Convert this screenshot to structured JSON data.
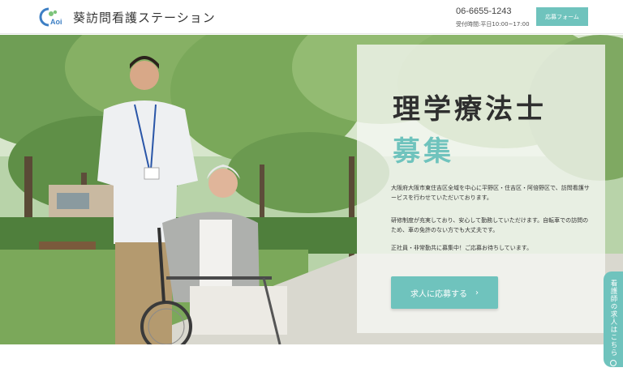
{
  "header": {
    "logo_text": "Aoi",
    "title": "葵訪問看護ステーション",
    "phone": "06-6655-1243",
    "hours": "受付時間:平日10:00~17:00",
    "apply_form_label": "応募フォーム"
  },
  "hero": {
    "headline": "理学療法士",
    "subheadline": "募集",
    "paragraphs": [
      "大阪府大阪市東住吉区全域を中心に平野区・住吉区・阿倍野区で、訪問看護サービスを行わせていただいております。",
      "研修制度が充実しており、安心して勤務していただけます。自転車での訪問のため、車の免許のない方でも大丈夫です。",
      "正社員・非常勤共に募集中！ご応募お待ちしています。"
    ],
    "cta_label": "求人に応募する",
    "cta_chevron": "›"
  },
  "side_tab": {
    "label": "看護師の求人はこちら"
  },
  "colors": {
    "accent": "#6fc3bd",
    "text_dark": "#2f2f2f"
  }
}
